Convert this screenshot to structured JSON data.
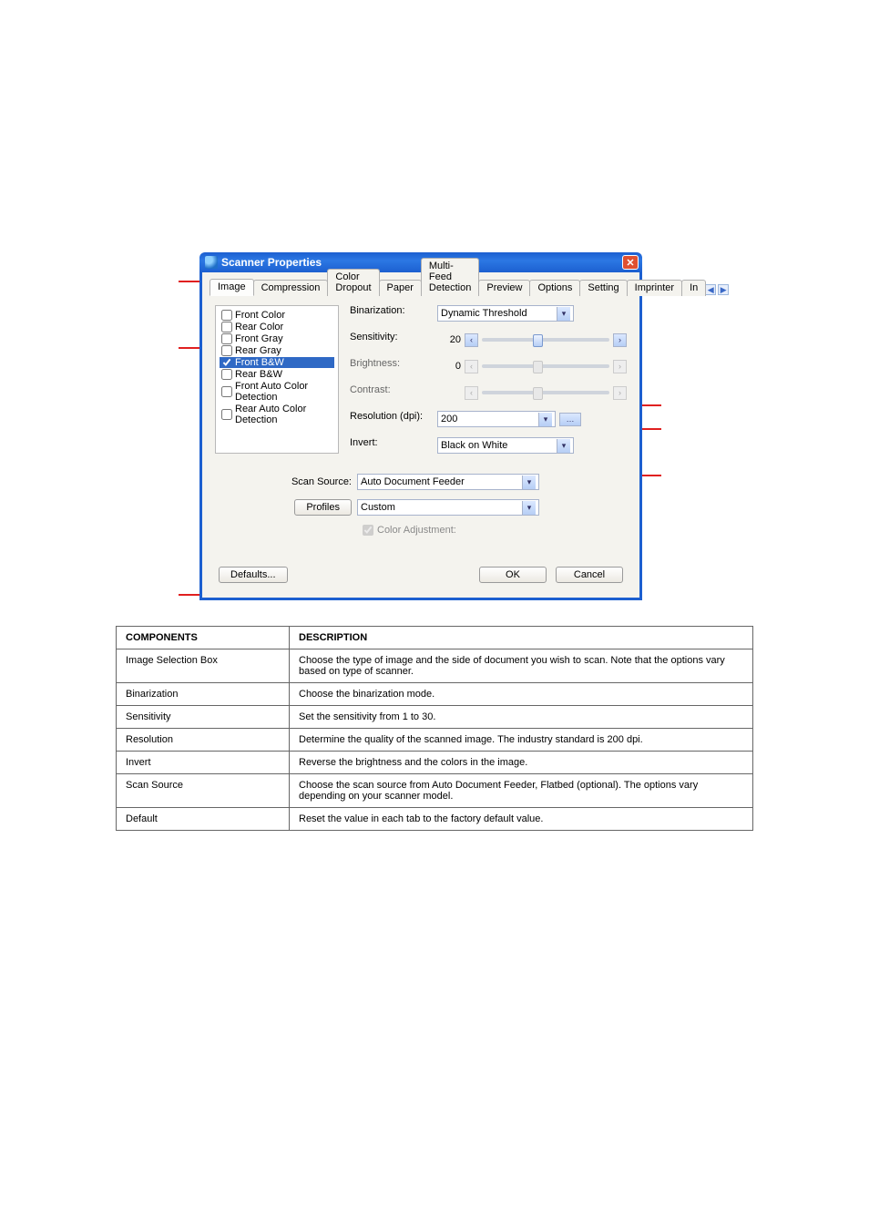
{
  "window": {
    "title": "Scanner Properties"
  },
  "tabs": [
    "Image",
    "Compression",
    "Color Dropout",
    "Paper",
    "Multi-Feed Detection",
    "Preview",
    "Options",
    "Setting",
    "Imprinter",
    "In"
  ],
  "active_tab": "Image",
  "checklist": [
    {
      "label": "Front Color",
      "checked": false,
      "selected": false
    },
    {
      "label": "Rear Color",
      "checked": false,
      "selected": false
    },
    {
      "label": "Front Gray",
      "checked": false,
      "selected": false
    },
    {
      "label": "Rear Gray",
      "checked": false,
      "selected": false
    },
    {
      "label": "Front B&W",
      "checked": true,
      "selected": true
    },
    {
      "label": "Rear B&W",
      "checked": false,
      "selected": false
    },
    {
      "label": "Front Auto Color Detection",
      "checked": false,
      "selected": false
    },
    {
      "label": "Rear Auto Color Detection",
      "checked": false,
      "selected": false
    }
  ],
  "settings": {
    "binarization": {
      "label": "Binarization:",
      "value": "Dynamic Threshold"
    },
    "sensitivity": {
      "label": "Sensitivity:",
      "value": "20"
    },
    "brightness": {
      "label": "Brightness:",
      "value": "0"
    },
    "contrast": {
      "label": "Contrast:",
      "value": ""
    },
    "resolution": {
      "label": "Resolution (dpi):",
      "value": "200"
    },
    "invert": {
      "label": "Invert:",
      "value": "Black on White"
    }
  },
  "scan_source": {
    "label": "Scan Source:",
    "value": "Auto Document Feeder"
  },
  "profiles": {
    "button": "Profiles",
    "value": "Custom"
  },
  "color_adjustment": {
    "label": "Color Adjustment:",
    "checked": true
  },
  "buttons": {
    "defaults": "Defaults...",
    "ok": "OK",
    "cancel": "Cancel"
  },
  "table": {
    "header": [
      "COMPONENTS",
      "DESCRIPTION"
    ],
    "rows": [
      [
        "Image Selection Box",
        "Choose the type of image and the side of document you wish to scan. Note that the options vary based on type of scanner."
      ],
      [
        "Binarization",
        "Choose the binarization mode."
      ],
      [
        "Sensitivity",
        "Set the sensitivity from 1 to 30."
      ],
      [
        "Resolution",
        "Determine the quality of the scanned image. The industry standard is 200 dpi."
      ],
      [
        "Invert",
        "Reverse the brightness and the colors in the image."
      ],
      [
        "Scan Source",
        "Choose the scan source from Auto Document Feeder, Flatbed (optional). The options vary depending on your scanner model."
      ],
      [
        "Default",
        "Reset the value in each tab to the factory default value."
      ]
    ]
  },
  "annotations_left": [
    {
      "row": 0,
      "target": "tab-image"
    },
    {
      "row": 1,
      "target": "chk-front-bw"
    },
    {
      "row": 6,
      "target": "defaults-btn"
    }
  ],
  "annotations_right": [
    {
      "row": 3,
      "target": "resolution-combo"
    },
    {
      "row": 4,
      "target": "invert-combo"
    },
    {
      "row": 5,
      "target": "scan-source-combo"
    }
  ]
}
